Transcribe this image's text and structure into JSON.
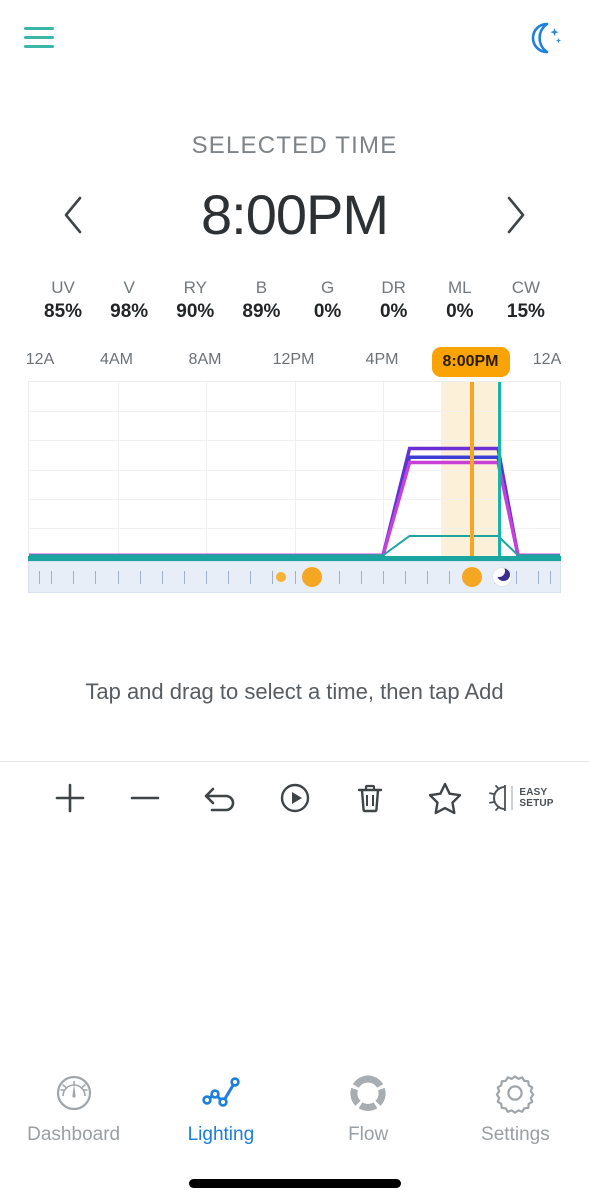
{
  "header": {
    "menu_icon": "hamburger-icon",
    "menu_color": "#3cb6a9",
    "night_icon": "moon-sparkle-icon",
    "night_color": "#1f7fe0"
  },
  "selected_time": {
    "label": "SELECTED TIME",
    "value": "8:00PM",
    "prev_icon": "chevron-left-icon",
    "next_icon": "chevron-right-icon"
  },
  "channels": [
    {
      "name": "UV",
      "value": "85%"
    },
    {
      "name": "V",
      "value": "98%"
    },
    {
      "name": "RY",
      "value": "90%"
    },
    {
      "name": "B",
      "value": "89%"
    },
    {
      "name": "G",
      "value": "0%"
    },
    {
      "name": "DR",
      "value": "0%"
    },
    {
      "name": "ML",
      "value": "0%"
    },
    {
      "name": "CW",
      "value": "15%"
    }
  ],
  "chart_data": {
    "type": "line",
    "title": "",
    "xlabel": "",
    "ylabel": "",
    "xlim": [
      0,
      24
    ],
    "ylim": [
      0,
      100
    ],
    "grid": true,
    "legend": "none",
    "tick_labels": [
      "12A",
      "4AM",
      "8AM",
      "12PM",
      "4PM",
      "8:00PM",
      "12A"
    ],
    "tick_hours": [
      0,
      4,
      8,
      12,
      16,
      20,
      24
    ],
    "selected_tick_index": 5,
    "selected_hour": 20,
    "selection_band": [
      18.6,
      21.4
    ],
    "cursor_hour": 20,
    "marker_hour": 21.2,
    "x": [
      0,
      16,
      17.2,
      20,
      21.2,
      22.1,
      24
    ],
    "series": [
      {
        "name": "V",
        "color": "#6b2fd6",
        "values": [
          1,
          1,
          62,
          62,
          62,
          1,
          1
        ]
      },
      {
        "name": "UV",
        "color": "#3d3fd4",
        "values": [
          1,
          1,
          57,
          57,
          57,
          1,
          1
        ]
      },
      {
        "name": "RY",
        "color": "#c940d8",
        "values": [
          1,
          1,
          54,
          54,
          54,
          1,
          1
        ]
      },
      {
        "name": "CW",
        "color": "#1aa5a0",
        "values": [
          1,
          1,
          12,
          12,
          12,
          1,
          1
        ]
      }
    ],
    "baseline_color": "#1aa5a0",
    "cursor_color": "#f5a623",
    "band_color": "#fdf0d9",
    "marker_color": "#17b3ac"
  },
  "scrubber": {
    "markers": [
      {
        "kind": "small-dot",
        "hour": 11.4,
        "icon": "sunrise-dot-icon"
      },
      {
        "kind": "large-dot",
        "hour": 12.8,
        "icon": "sun-dot-icon"
      },
      {
        "kind": "large-dot",
        "hour": 20.0,
        "icon": "sun-dot-icon"
      },
      {
        "kind": "moon",
        "hour": 21.4,
        "icon": "moon-marker-icon"
      }
    ]
  },
  "hint": {
    "text": "Tap and drag to select a time, then tap Add"
  },
  "toolbar": [
    {
      "icon": "plus-icon",
      "label": ""
    },
    {
      "icon": "minus-icon",
      "label": ""
    },
    {
      "icon": "undo-icon",
      "label": ""
    },
    {
      "icon": "play-circle-icon",
      "label": ""
    },
    {
      "icon": "trash-icon",
      "label": ""
    },
    {
      "icon": "star-icon",
      "label": ""
    },
    {
      "icon": "brightness-icon",
      "label": "EASY SETUP",
      "label_line1": "EASY",
      "label_line2": "SETUP"
    }
  ],
  "bottom_nav": {
    "active_index": 1,
    "active_color": "#1b7fe0",
    "items": [
      {
        "label": "Dashboard",
        "icon": "gauge-icon"
      },
      {
        "label": "Lighting",
        "icon": "line-chart-icon"
      },
      {
        "label": "Flow",
        "icon": "donut-icon"
      },
      {
        "label": "Settings",
        "icon": "gear-icon"
      }
    ]
  }
}
